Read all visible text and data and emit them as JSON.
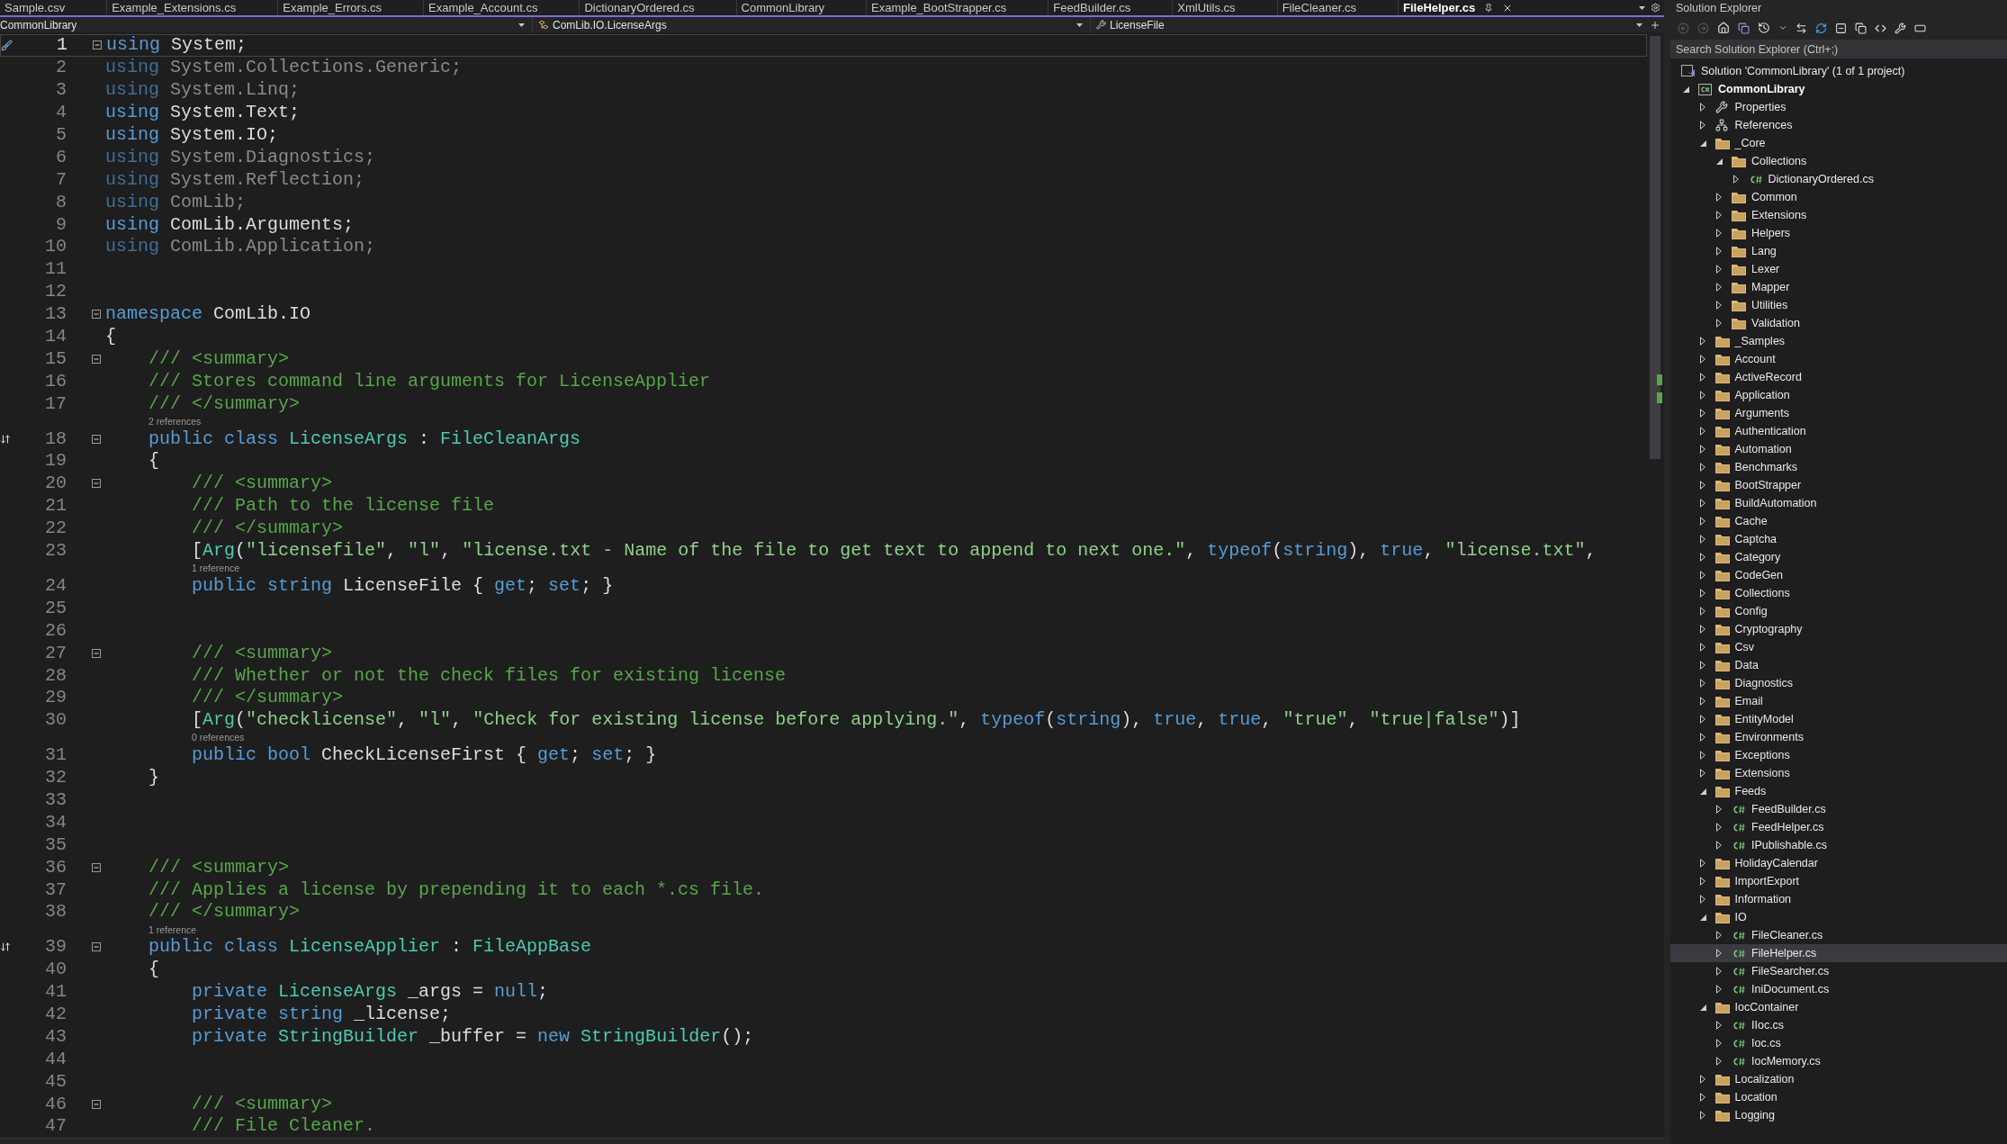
{
  "tabs": [
    {
      "label": "Sample.csv",
      "selected": false
    },
    {
      "label": "Example_Extensions.cs",
      "selected": false
    },
    {
      "label": "Example_Errors.cs",
      "selected": false
    },
    {
      "label": "Example_Account.cs",
      "selected": false
    },
    {
      "label": "DictionaryOrdered.cs",
      "selected": false
    },
    {
      "label": "CommonLibrary",
      "selected": false
    },
    {
      "label": "Example_BootStrapper.cs",
      "selected": false
    },
    {
      "label": "FeedBuilder.cs",
      "selected": false
    },
    {
      "label": "XmlUtils.cs",
      "selected": false
    },
    {
      "label": "FileCleaner.cs",
      "selected": false
    },
    {
      "label": "FileHelper.cs",
      "selected": true
    }
  ],
  "navigation_bar": {
    "project": "CommonLibrary",
    "type": "ComLib.IO.LicenseArgs",
    "member": "LicenseFile"
  },
  "lines": [
    {
      "number": "1",
      "fold": true,
      "margin": {
        "kind": "brush"
      },
      "code": [
        {
          "kind": "keyword",
          "text": "using"
        },
        {
          "kind": "plain",
          "text": " System;"
        }
      ]
    },
    {
      "number": "2",
      "fold": false,
      "code": [
        {
          "kind": "fadedkw",
          "text": "using"
        },
        {
          "kind": "faded",
          "text": " System.Collections.Generic;"
        }
      ]
    },
    {
      "number": "3",
      "fold": false,
      "code": [
        {
          "kind": "fadedkw",
          "text": "using"
        },
        {
          "kind": "faded",
          "text": " System.Linq;"
        }
      ]
    },
    {
      "number": "4",
      "fold": false,
      "code": [
        {
          "kind": "keyword",
          "text": "using"
        },
        {
          "kind": "plain",
          "text": " System.Text;"
        }
      ]
    },
    {
      "number": "5",
      "fold": false,
      "code": [
        {
          "kind": "keyword",
          "text": "using"
        },
        {
          "kind": "plain",
          "text": " System.IO;"
        }
      ]
    },
    {
      "number": "6",
      "fold": false,
      "code": [
        {
          "kind": "fadedkw",
          "text": "using"
        },
        {
          "kind": "faded",
          "text": " System.Diagnostics;"
        }
      ]
    },
    {
      "number": "7",
      "fold": false,
      "code": [
        {
          "kind": "fadedkw",
          "text": "using"
        },
        {
          "kind": "faded",
          "text": " System.Reflection;"
        }
      ]
    },
    {
      "number": "8",
      "fold": false,
      "code": [
        {
          "kind": "fadedkw",
          "text": "using"
        },
        {
          "kind": "faded",
          "text": " ComLib;"
        }
      ]
    },
    {
      "number": "9",
      "fold": false,
      "code": [
        {
          "kind": "keyword",
          "text": "using"
        },
        {
          "kind": "plain",
          "text": " ComLib.Arguments;"
        }
      ]
    },
    {
      "number": "10",
      "fold": false,
      "code": [
        {
          "kind": "fadedkw",
          "text": "using"
        },
        {
          "kind": "faded",
          "text": " ComLib.Application;"
        }
      ]
    },
    {
      "number": "11",
      "fold": false
    },
    {
      "number": "12",
      "fold": false
    },
    {
      "number": "13",
      "fold": true,
      "code": [
        {
          "kind": "keyword",
          "text": "namespace"
        },
        {
          "kind": "plain",
          "text": " ComLib.IO"
        }
      ]
    },
    {
      "number": "14",
      "fold": false,
      "code": [
        {
          "kind": "plain",
          "text": "{"
        }
      ]
    },
    {
      "number": "15",
      "fold": true,
      "code": [
        {
          "kind": "comment",
          "text": "    /// <summary>"
        }
      ]
    },
    {
      "number": "16",
      "fold": false,
      "code": [
        {
          "kind": "comment",
          "text": "    /// Stores command line arguments for LicenseApplier"
        }
      ]
    },
    {
      "number": "17",
      "fold": false,
      "code": [
        {
          "kind": "comment",
          "text": "    /// </summary>"
        }
      ]
    },
    {
      "number": "18",
      "fold": true,
      "margin": {
        "kind": "inheritance"
      },
      "references": "2 references",
      "code": [
        {
          "kind": "keyword",
          "text": "    public class"
        },
        {
          "kind": "type",
          "text": " LicenseArgs"
        },
        {
          "kind": "plain",
          "text": " : "
        },
        {
          "kind": "type",
          "text": "FileCleanArgs"
        }
      ]
    },
    {
      "number": "19",
      "fold": false,
      "code": [
        {
          "kind": "plain",
          "text": "    {"
        }
      ]
    },
    {
      "number": "20",
      "fold": true,
      "code": [
        {
          "kind": "comment",
          "text": "        /// <summary>"
        }
      ]
    },
    {
      "number": "21",
      "fold": false,
      "code": [
        {
          "kind": "comment",
          "text": "        /// Path to the license file"
        }
      ]
    },
    {
      "number": "22",
      "fold": false,
      "code": [
        {
          "kind": "comment",
          "text": "        /// </summary>"
        }
      ]
    },
    {
      "number": "23",
      "fold": false,
      "code": [
        {
          "kind": "plain",
          "text": "        ["
        },
        {
          "kind": "type",
          "text": "Arg"
        },
        {
          "kind": "plain",
          "text": "("
        },
        {
          "kind": "string",
          "text": "\"licensefile\""
        },
        {
          "kind": "plain",
          "text": ", "
        },
        {
          "kind": "string",
          "text": "\"l\""
        },
        {
          "kind": "plain",
          "text": ", "
        },
        {
          "kind": "string",
          "text": "\"license.txt - Name of the file to get text to append to next one.\""
        },
        {
          "kind": "plain",
          "text": ", "
        },
        {
          "kind": "keyword",
          "text": "typeof"
        },
        {
          "kind": "plain",
          "text": "("
        },
        {
          "kind": "keyword",
          "text": "string"
        },
        {
          "kind": "plain",
          "text": "), "
        },
        {
          "kind": "keyword",
          "text": "true"
        },
        {
          "kind": "plain",
          "text": ", "
        },
        {
          "kind": "string",
          "text": "\"license.txt\""
        },
        {
          "kind": "plain",
          "text": ","
        }
      ]
    },
    {
      "number": "24",
      "fold": false,
      "references": "1 reference",
      "code": [
        {
          "kind": "keyword",
          "text": "        public string"
        },
        {
          "kind": "plain",
          "text": " LicenseFile { "
        },
        {
          "kind": "keyword",
          "text": "get"
        },
        {
          "kind": "plain",
          "text": "; "
        },
        {
          "kind": "keyword",
          "text": "set"
        },
        {
          "kind": "plain",
          "text": "; }"
        }
      ]
    },
    {
      "number": "25",
      "fold": false
    },
    {
      "number": "26",
      "fold": false
    },
    {
      "number": "27",
      "fold": true,
      "code": [
        {
          "kind": "comment",
          "text": "        /// <summary>"
        }
      ]
    },
    {
      "number": "28",
      "fold": false,
      "code": [
        {
          "kind": "comment",
          "text": "        /// Whether or not the check files for existing license"
        }
      ]
    },
    {
      "number": "29",
      "fold": false,
      "code": [
        {
          "kind": "comment",
          "text": "        /// </summary>"
        }
      ]
    },
    {
      "number": "30",
      "fold": false,
      "code": [
        {
          "kind": "plain",
          "text": "        ["
        },
        {
          "kind": "type",
          "text": "Arg"
        },
        {
          "kind": "plain",
          "text": "("
        },
        {
          "kind": "string",
          "text": "\"checklicense\""
        },
        {
          "kind": "plain",
          "text": ", "
        },
        {
          "kind": "string",
          "text": "\"l\""
        },
        {
          "kind": "plain",
          "text": ", "
        },
        {
          "kind": "string",
          "text": "\"Check for existing license before applying.\""
        },
        {
          "kind": "plain",
          "text": ", "
        },
        {
          "kind": "keyword",
          "text": "typeof"
        },
        {
          "kind": "plain",
          "text": "("
        },
        {
          "kind": "keyword",
          "text": "string"
        },
        {
          "kind": "plain",
          "text": "), "
        },
        {
          "kind": "keyword",
          "text": "true"
        },
        {
          "kind": "plain",
          "text": ", "
        },
        {
          "kind": "keyword",
          "text": "true"
        },
        {
          "kind": "plain",
          "text": ", "
        },
        {
          "kind": "string",
          "text": "\"true\""
        },
        {
          "kind": "plain",
          "text": ", "
        },
        {
          "kind": "string",
          "text": "\"true|false\""
        },
        {
          "kind": "plain",
          "text": ")]"
        }
      ]
    },
    {
      "number": "31",
      "fold": false,
      "references": "0 references",
      "code": [
        {
          "kind": "keyword",
          "text": "        public bool"
        },
        {
          "kind": "plain",
          "text": " CheckLicenseFirst { "
        },
        {
          "kind": "keyword",
          "text": "get"
        },
        {
          "kind": "plain",
          "text": "; "
        },
        {
          "kind": "keyword",
          "text": "set"
        },
        {
          "kind": "plain",
          "text": "; }"
        }
      ]
    },
    {
      "number": "32",
      "fold": false,
      "code": [
        {
          "kind": "plain",
          "text": "    }"
        }
      ]
    },
    {
      "number": "33",
      "fold": false
    },
    {
      "number": "34",
      "fold": false
    },
    {
      "number": "35",
      "fold": false
    },
    {
      "number": "36",
      "fold": true,
      "code": [
        {
          "kind": "comment",
          "text": "    /// <summary>"
        }
      ]
    },
    {
      "number": "37",
      "fold": false,
      "code": [
        {
          "kind": "comment",
          "text": "    /// Applies a license by prepending it to each *.cs file."
        }
      ]
    },
    {
      "number": "38",
      "fold": false,
      "code": [
        {
          "kind": "comment",
          "text": "    /// </summary>"
        }
      ]
    },
    {
      "number": "39",
      "fold": true,
      "margin": {
        "kind": "inheritance"
      },
      "references": "1 reference",
      "code": [
        {
          "kind": "keyword",
          "text": "    public class"
        },
        {
          "kind": "type",
          "text": " LicenseApplier"
        },
        {
          "kind": "plain",
          "text": " : "
        },
        {
          "kind": "type",
          "text": "FileAppBase"
        }
      ]
    },
    {
      "number": "40",
      "fold": false,
      "code": [
        {
          "kind": "plain",
          "text": "    {"
        }
      ]
    },
    {
      "number": "41",
      "fold": false,
      "code": [
        {
          "kind": "keyword",
          "text": "        private"
        },
        {
          "kind": "type",
          "text": " LicenseArgs"
        },
        {
          "kind": "plain",
          "text": " _args = "
        },
        {
          "kind": "keyword",
          "text": "null"
        },
        {
          "kind": "plain",
          "text": ";"
        }
      ]
    },
    {
      "number": "42",
      "fold": false,
      "code": [
        {
          "kind": "keyword",
          "text": "        private string"
        },
        {
          "kind": "plain",
          "text": " _license;"
        }
      ]
    },
    {
      "number": "43",
      "fold": false,
      "code": [
        {
          "kind": "keyword",
          "text": "        private"
        },
        {
          "kind": "type",
          "text": " StringBuilder"
        },
        {
          "kind": "plain",
          "text": " _buffer = "
        },
        {
          "kind": "keyword",
          "text": "new"
        },
        {
          "kind": "type",
          "text": " StringBuilder"
        },
        {
          "kind": "plain",
          "text": "();"
        }
      ]
    },
    {
      "number": "44",
      "fold": false
    },
    {
      "number": "45",
      "fold": false
    },
    {
      "number": "46",
      "fold": true,
      "code": [
        {
          "kind": "comment",
          "text": "        /// <summary>"
        }
      ]
    },
    {
      "number": "47",
      "fold": false,
      "code": [
        {
          "kind": "comment",
          "text": "        /// File Cleaner."
        }
      ]
    }
  ],
  "solution_explorer": {
    "title": "Solution Explorer",
    "search": {
      "placeholder": "Search Solution Explorer (Ctrl+;)"
    },
    "solution": {
      "label": "Solution 'CommonLibrary' (1 of 1 project)"
    },
    "tree": [
      {
        "label": "CommonLibrary",
        "kind": "project",
        "expanded": true,
        "selected": false,
        "children": [
          {
            "label": "Properties",
            "kind": "properties",
            "expanded": false,
            "selected": false
          },
          {
            "label": "References",
            "kind": "references",
            "expanded": false,
            "selected": false
          },
          {
            "label": "_Core",
            "kind": "folder",
            "expanded": true,
            "selected": false,
            "children": [
              {
                "label": "Collections",
                "kind": "folder",
                "expanded": true,
                "selected": false,
                "children": [
                  {
                    "label": "DictionaryOrdered.cs",
                    "kind": "file",
                    "expanded": false,
                    "selected": false
                  }
                ]
              },
              {
                "label": "Common",
                "kind": "folder",
                "expanded": false,
                "selected": false
              },
              {
                "label": "Extensions",
                "kind": "folder",
                "expanded": false,
                "selected": false
              },
              {
                "label": "Helpers",
                "kind": "folder",
                "expanded": false,
                "selected": false
              },
              {
                "label": "Lang",
                "kind": "folder",
                "expanded": false,
                "selected": false
              },
              {
                "label": "Lexer",
                "kind": "folder",
                "expanded": false,
                "selected": false
              },
              {
                "label": "Mapper",
                "kind": "folder",
                "expanded": false,
                "selected": false
              },
              {
                "label": "Utilities",
                "kind": "folder",
                "expanded": false,
                "selected": false
              },
              {
                "label": "Validation",
                "kind": "folder",
                "expanded": false,
                "selected": false
              }
            ]
          },
          {
            "label": "_Samples",
            "kind": "folder",
            "expanded": false,
            "selected": false
          },
          {
            "label": "Account",
            "kind": "folder",
            "expanded": false,
            "selected": false
          },
          {
            "label": "ActiveRecord",
            "kind": "folder",
            "expanded": false,
            "selected": false
          },
          {
            "label": "Application",
            "kind": "folder",
            "expanded": false,
            "selected": false
          },
          {
            "label": "Arguments",
            "kind": "folder",
            "expanded": false,
            "selected": false
          },
          {
            "label": "Authentication",
            "kind": "folder",
            "expanded": false,
            "selected": false
          },
          {
            "label": "Automation",
            "kind": "folder",
            "expanded": false,
            "selected": false
          },
          {
            "label": "Benchmarks",
            "kind": "folder",
            "expanded": false,
            "selected": false
          },
          {
            "label": "BootStrapper",
            "kind": "folder",
            "expanded": false,
            "selected": false
          },
          {
            "label": "BuildAutomation",
            "kind": "folder",
            "expanded": false,
            "selected": false
          },
          {
            "label": "Cache",
            "kind": "folder",
            "expanded": false,
            "selected": false
          },
          {
            "label": "Captcha",
            "kind": "folder",
            "expanded": false,
            "selected": false
          },
          {
            "label": "Category",
            "kind": "folder",
            "expanded": false,
            "selected": false
          },
          {
            "label": "CodeGen",
            "kind": "folder",
            "expanded": false,
            "selected": false
          },
          {
            "label": "Collections",
            "kind": "folder",
            "expanded": false,
            "selected": false
          },
          {
            "label": "Config",
            "kind": "folder",
            "expanded": false,
            "selected": false
          },
          {
            "label": "Cryptography",
            "kind": "folder",
            "expanded": false,
            "selected": false
          },
          {
            "label": "Csv",
            "kind": "folder",
            "expanded": false,
            "selected": false
          },
          {
            "label": "Data",
            "kind": "folder",
            "expanded": false,
            "selected": false
          },
          {
            "label": "Diagnostics",
            "kind": "folder",
            "expanded": false,
            "selected": false
          },
          {
            "label": "Email",
            "kind": "folder",
            "expanded": false,
            "selected": false
          },
          {
            "label": "EntityModel",
            "kind": "folder",
            "expanded": false,
            "selected": false
          },
          {
            "label": "Environments",
            "kind": "folder",
            "expanded": false,
            "selected": false
          },
          {
            "label": "Exceptions",
            "kind": "folder",
            "expanded": false,
            "selected": false
          },
          {
            "label": "Extensions",
            "kind": "folder",
            "expanded": false,
            "selected": false
          },
          {
            "label": "Feeds",
            "kind": "folder",
            "expanded": true,
            "selected": false,
            "children": [
              {
                "label": "FeedBuilder.cs",
                "kind": "file",
                "expanded": false,
                "selected": false
              },
              {
                "label": "FeedHelper.cs",
                "kind": "file",
                "expanded": false,
                "selected": false
              },
              {
                "label": "IPublishable.cs",
                "kind": "file",
                "expanded": false,
                "selected": false
              }
            ]
          },
          {
            "label": "HolidayCalendar",
            "kind": "folder",
            "expanded": false,
            "selected": false
          },
          {
            "label": "ImportExport",
            "kind": "folder",
            "expanded": false,
            "selected": false
          },
          {
            "label": "Information",
            "kind": "folder",
            "expanded": false,
            "selected": false
          },
          {
            "label": "IO",
            "kind": "folder",
            "expanded": true,
            "selected": false,
            "children": [
              {
                "label": "FileCleaner.cs",
                "kind": "file",
                "expanded": false,
                "selected": false
              },
              {
                "label": "FileHelper.cs",
                "kind": "file",
                "expanded": false,
                "selected": true
              },
              {
                "label": "FileSearcher.cs",
                "kind": "file",
                "expanded": false,
                "selected": false
              },
              {
                "label": "IniDocument.cs",
                "kind": "file",
                "expanded": false,
                "selected": false
              }
            ]
          },
          {
            "label": "IocContainer",
            "kind": "folder",
            "expanded": true,
            "selected": false,
            "children": [
              {
                "label": "IIoc.cs",
                "kind": "file",
                "expanded": false,
                "selected": false
              },
              {
                "label": "Ioc.cs",
                "kind": "file",
                "expanded": false,
                "selected": false
              },
              {
                "label": "IocMemory.cs",
                "kind": "file",
                "expanded": false,
                "selected": false
              }
            ]
          },
          {
            "label": "Localization",
            "kind": "folder",
            "expanded": false,
            "selected": false
          },
          {
            "label": "Location",
            "kind": "folder",
            "expanded": false,
            "selected": false
          },
          {
            "label": "Logging",
            "kind": "folder",
            "expanded": false,
            "selected": false
          }
        ]
      }
    ]
  }
}
